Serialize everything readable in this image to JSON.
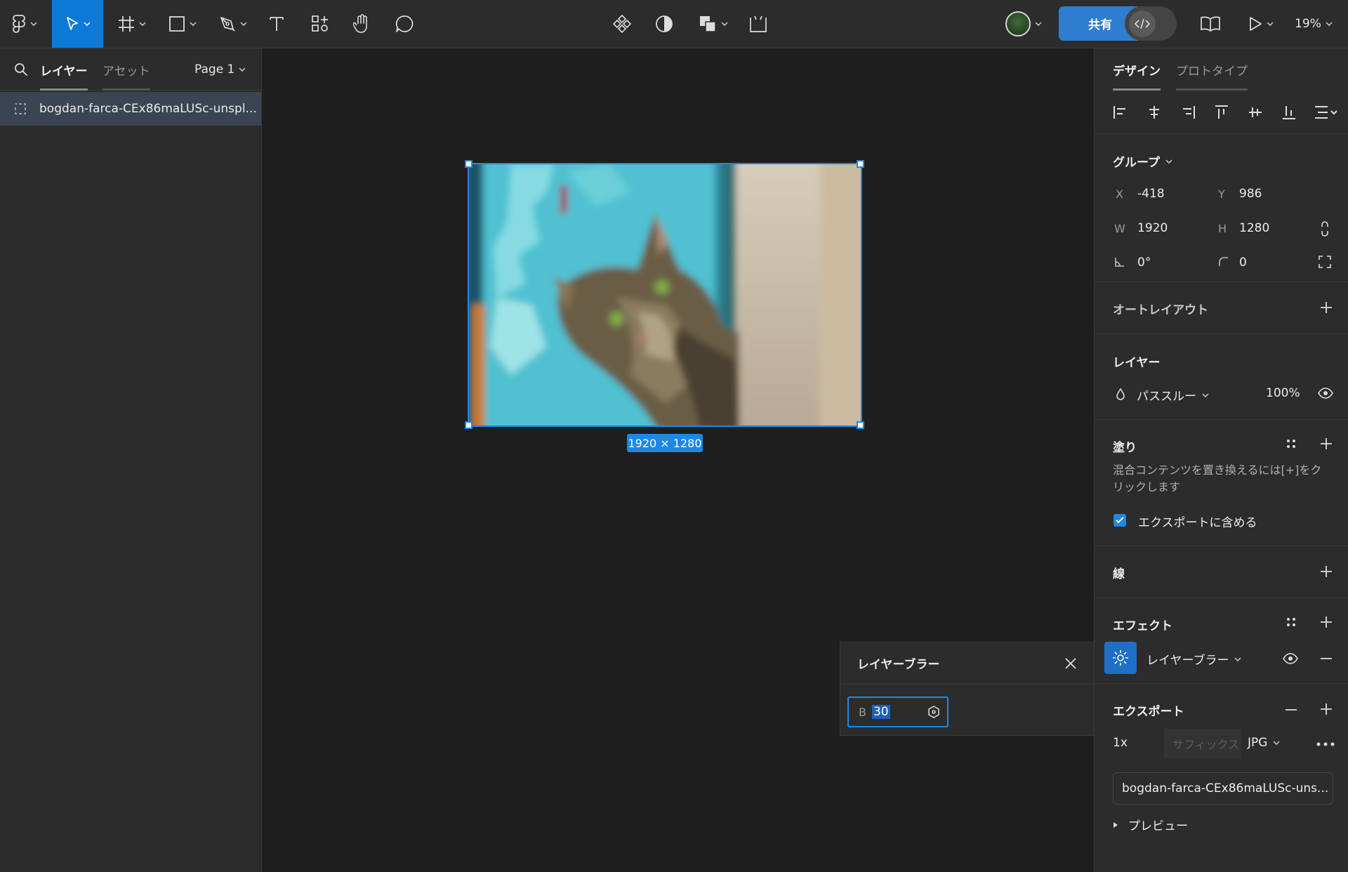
{
  "toolbar": {
    "share_label": "共有",
    "zoom_label": "19%",
    "icons": [
      "figma-menu-icon",
      "move-tool-icon",
      "frame-tool-icon",
      "rectangle-tool-icon",
      "pen-tool-icon",
      "text-tool-icon",
      "resources-icon",
      "hand-tool-icon",
      "comment-icon",
      "component-icon",
      "mask-icon",
      "boolean-icon",
      "crop-icon",
      "avatar",
      "dev-mode-icon",
      "library-icon",
      "present-icon"
    ]
  },
  "left_panel": {
    "tabs": [
      "レイヤー",
      "アセット"
    ],
    "page_label": "Page 1",
    "layers": [
      {
        "name": "bogdan-farca-CEx86maLUSc-unspl..."
      }
    ]
  },
  "canvas": {
    "size_badge": "1920 × 1280"
  },
  "blur_popover": {
    "title": "レイヤーブラー",
    "field_label": "B",
    "field_value": "30"
  },
  "right_panel": {
    "tabs": [
      "デザイン",
      "プロトタイプ"
    ],
    "group": {
      "title": "グループ",
      "x_label": "X",
      "x_value": "-418",
      "y_label": "Y",
      "y_value": "986",
      "w_label": "W",
      "w_value": "1920",
      "h_label": "H",
      "h_value": "1280",
      "rotation_value": "0°",
      "radius_value": "0"
    },
    "auto_layout": {
      "title": "オートレイアウト"
    },
    "layer": {
      "title": "レイヤー",
      "blend_mode": "パススルー",
      "opacity": "100%"
    },
    "fill": {
      "title": "塗り",
      "hint": "混合コンテンツを置き換えるには[+]をクリックします",
      "hint_line1": "混合コンテンツを置き換えるには[+]をク",
      "hint_line2": "リックします",
      "export_check_label": "エクスポートに含める"
    },
    "stroke": {
      "title": "線"
    },
    "effects": {
      "title": "エフェクト",
      "effect_name": "レイヤーブラー"
    },
    "export": {
      "title": "エクスポート",
      "scale": "1x",
      "suffix_placeholder": "サフィックス",
      "format": "JPG",
      "filename": "bogdan-farca-CEx86maLUSc-uns...",
      "preview_label": "プレビュー"
    }
  },
  "colors": {
    "accent": "#1e88e5",
    "share": "#2e7dd1",
    "panel": "#2c2c2c",
    "canvas": "#1e1e1e"
  }
}
